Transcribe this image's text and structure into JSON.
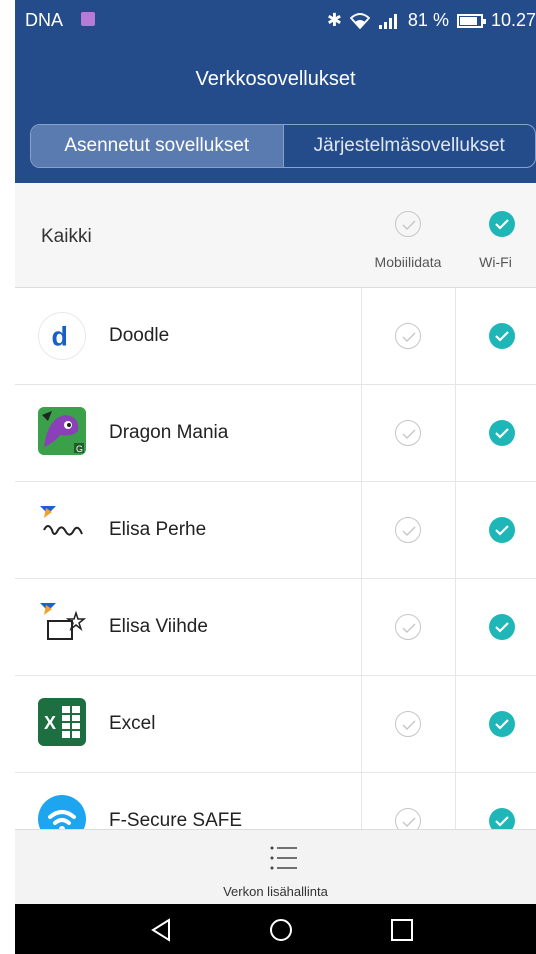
{
  "status_bar": {
    "carrier": "DNA",
    "battery_percent": "81 %",
    "time": "10.27"
  },
  "header": {
    "title": "Verkkosovellukset"
  },
  "tabs": [
    {
      "label": "Asennetut sovellukset",
      "active": true
    },
    {
      "label": "Järjestelmäsovellukset",
      "active": false
    }
  ],
  "all_row": {
    "label": "Kaikki",
    "mobile_checked": false,
    "wifi_checked": true
  },
  "columns": {
    "mobile": "Mobiilidata",
    "wifi": "Wi-Fi"
  },
  "apps": [
    {
      "name": "Doodle",
      "icon": "doodle-icon",
      "mobile": false,
      "wifi": true
    },
    {
      "name": "Dragon Mania",
      "icon": "dragon-mania-icon",
      "mobile": false,
      "wifi": true
    },
    {
      "name": "Elisa Perhe",
      "icon": "elisa-perhe-icon",
      "mobile": false,
      "wifi": true
    },
    {
      "name": "Elisa Viihde",
      "icon": "elisa-viihde-icon",
      "mobile": false,
      "wifi": true
    },
    {
      "name": "Excel",
      "icon": "excel-icon",
      "mobile": false,
      "wifi": true
    },
    {
      "name": "F-Secure SAFE",
      "icon": "f-secure-safe-icon",
      "mobile": false,
      "wifi": true
    }
  ],
  "bottom": {
    "label": "Verkon lisähallinta",
    "icon": "menu-list-icon"
  },
  "colors": {
    "header": "#244c8a",
    "tab_active": "#5a7bb0",
    "check_on": "#1fb6b8"
  }
}
